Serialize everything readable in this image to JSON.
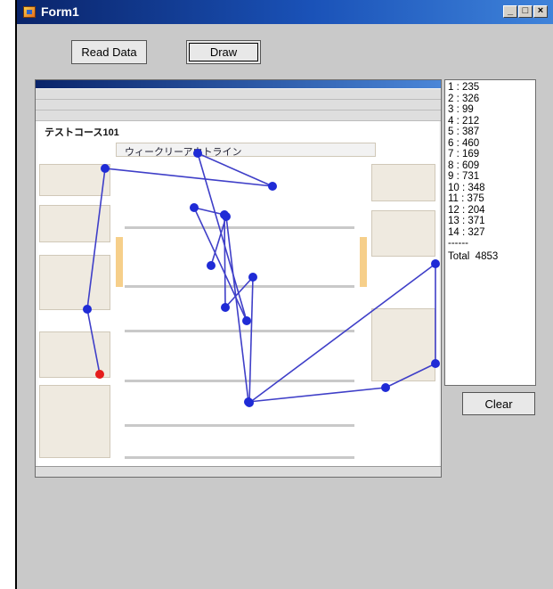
{
  "window": {
    "title": "Form1"
  },
  "buttons": {
    "read_label": "Read Data",
    "draw_label": "Draw",
    "clear_label": "Clear"
  },
  "titlebar_buttons": {
    "minimize": "_",
    "maximize": "□",
    "close": "×"
  },
  "list": {
    "items": [
      "1 : 235",
      "2 : 326",
      "3 : 99",
      "4 : 212",
      "5 : 387",
      "6 : 460",
      "7 : 169",
      "8 : 609",
      "9 : 731",
      "10 : 348",
      "11 : 375",
      "12 : 204",
      "13 : 371",
      "14 : 327"
    ],
    "separator": "------",
    "total": "Total  4853"
  },
  "screenshot": {
    "heading": "テストコース101",
    "section_title": "ウィークリーアウトライン"
  },
  "colors": {
    "path_line": "#3f3fc8",
    "point": "#1f2bd6",
    "start_point": "#e51c1c"
  }
}
